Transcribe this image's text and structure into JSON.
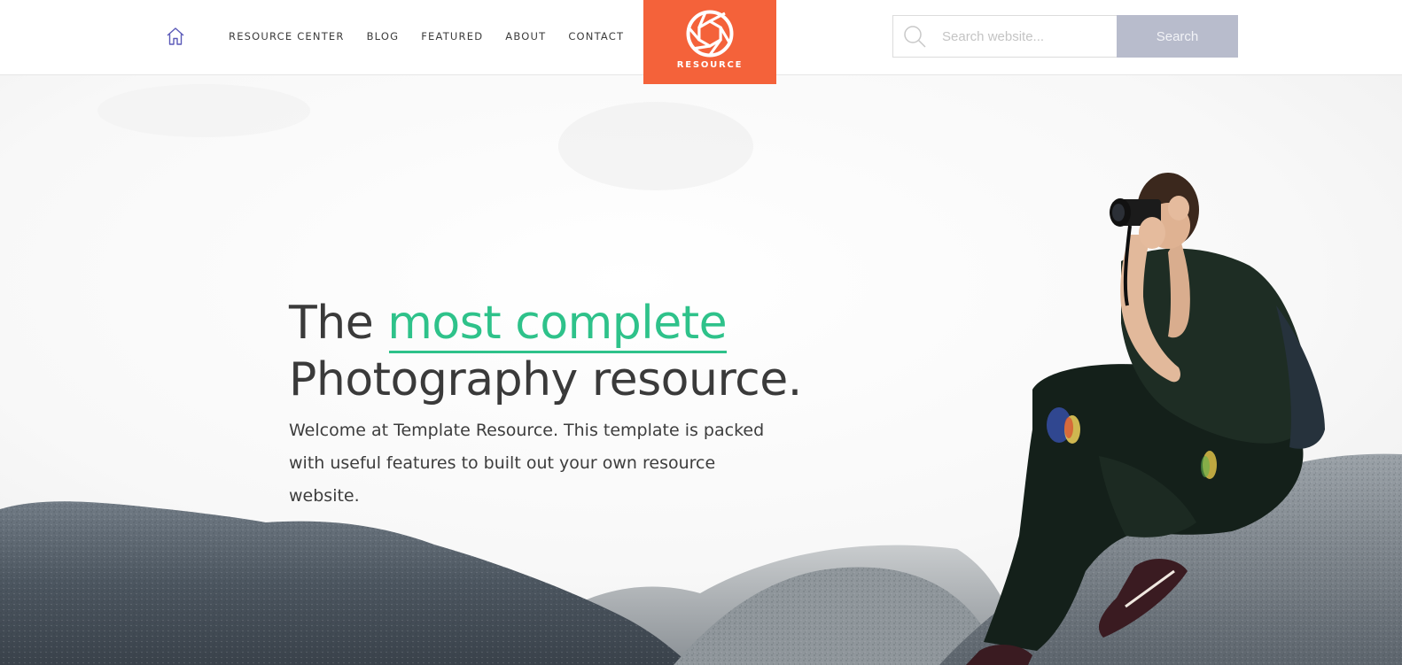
{
  "header": {
    "home_icon": "home-icon",
    "nav": [
      {
        "label": "RESOURCE CENTER"
      },
      {
        "label": "BLOG"
      },
      {
        "label": "FEATURED"
      },
      {
        "label": "ABOUT"
      },
      {
        "label": "CONTACT"
      }
    ],
    "logo": {
      "icon": "aperture-icon",
      "text": "RESOURCE",
      "color": "#f4623a"
    },
    "search": {
      "placeholder": "Search website...",
      "value": "",
      "button_label": "Search",
      "icon": "search-icon"
    }
  },
  "hero": {
    "headline_prefix": "The ",
    "headline_accent": "most complete",
    "headline_line2": "Photography resource.",
    "intro": "Welcome at Template Resource. This template is packed with useful features to built out your own resource website.",
    "accent_color": "#2ec28a",
    "image": "photographer-on-rocks"
  }
}
